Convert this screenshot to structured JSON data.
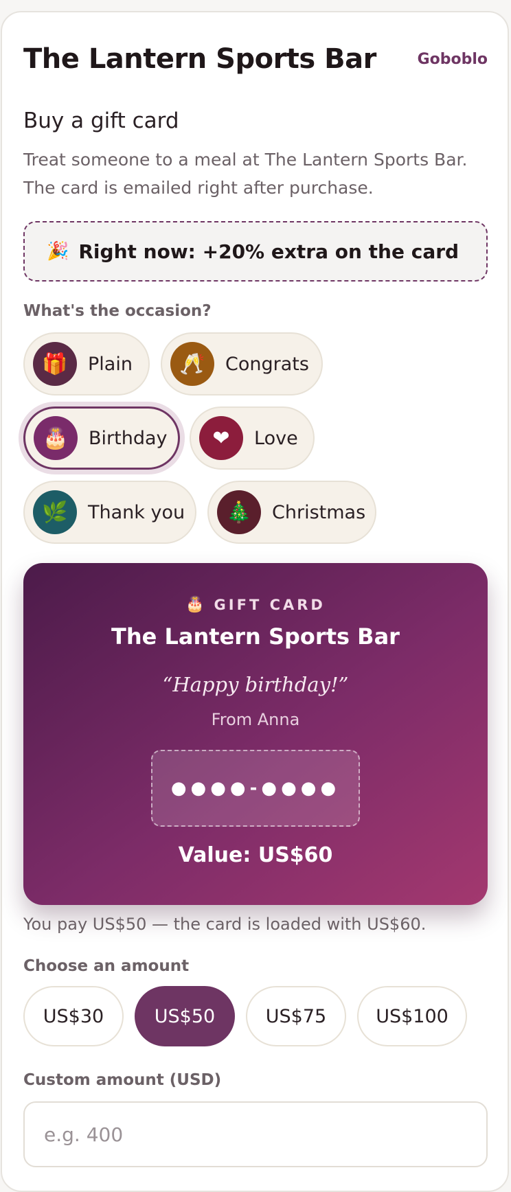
{
  "header": {
    "title": "The Lantern Sports Bar",
    "brand": "Goboblo"
  },
  "intro": {
    "heading": "Buy a gift card",
    "description": "Treat someone to a meal at The Lantern Sports Bar. The card is emailed right after purchase."
  },
  "promo": {
    "icon": "party-popper-icon",
    "text": "Right now: +20% extra on the card"
  },
  "occasion": {
    "label": "What's the occasion?",
    "selected": "Birthday",
    "options": [
      {
        "label": "Plain",
        "icon": "gift-icon",
        "emoji": "🎁",
        "color": "#5a2a45"
      },
      {
        "label": "Congrats",
        "icon": "champagne-icon",
        "emoji": "🥂",
        "color": "#9a5a12"
      },
      {
        "label": "Birthday",
        "icon": "cake-icon",
        "emoji": "🎂",
        "color": "#7a2b6a"
      },
      {
        "label": "Love",
        "icon": "heart-icon",
        "emoji": "❤",
        "color": "#8c1d3c"
      },
      {
        "label": "Thank you",
        "icon": "leaf-icon",
        "emoji": "🌿",
        "color": "#1d5d66"
      },
      {
        "label": "Christmas",
        "icon": "tree-icon",
        "emoji": "🎄",
        "color": "#5a1f2c"
      }
    ]
  },
  "card": {
    "icon": "cake-icon",
    "tag": "GIFT CARD",
    "name": "The Lantern Sports Bar",
    "message": "“Happy birthday!”",
    "from": "From Anna",
    "code": "●●●●-●●●●",
    "value": "Value: US$60"
  },
  "pay_note": "You pay US$50 — the card is loaded with US$60.",
  "amounts": {
    "label": "Choose an amount",
    "selected": "US$50",
    "options": [
      "US$30",
      "US$50",
      "US$75",
      "US$100"
    ]
  },
  "custom": {
    "label": "Custom amount (USD)",
    "placeholder": "e.g. 400",
    "value": ""
  },
  "colors": {
    "accent": "#6e3563",
    "chip_bg": "#f6f1e9"
  }
}
